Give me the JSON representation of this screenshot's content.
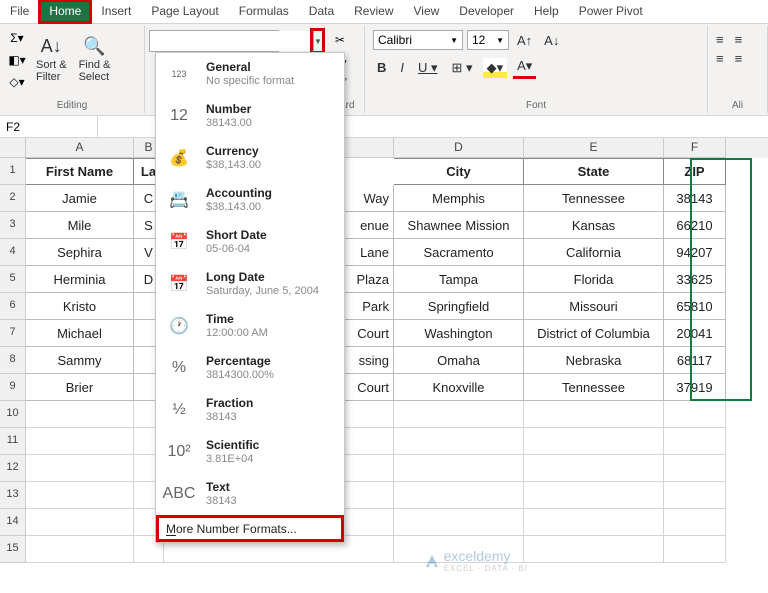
{
  "menu": [
    "File",
    "Home",
    "Insert",
    "Page Layout",
    "Formulas",
    "Data",
    "Review",
    "View",
    "Developer",
    "Help",
    "Power Pivot"
  ],
  "menu_active_index": 1,
  "ribbon": {
    "editing": {
      "sort_filter": "Sort &\nFilter",
      "find_select": "Find &\nSelect",
      "group_label": "Editing"
    },
    "font": {
      "name": "Calibri",
      "size": "12",
      "group_label": "Font"
    },
    "align": {
      "group_label": "Ali"
    },
    "board_label": "oard"
  },
  "numfmt_dropdown": [
    {
      "title": "General",
      "sub": "No specific format",
      "icon": "123"
    },
    {
      "title": "Number",
      "sub": "38143.00",
      "icon": "12"
    },
    {
      "title": "Currency",
      "sub": "$38,143.00",
      "icon": "coins"
    },
    {
      "title": "Accounting",
      "sub": "$38,143.00",
      "icon": "ledger"
    },
    {
      "title": "Short Date",
      "sub": "05-06-04",
      "icon": "cal"
    },
    {
      "title": "Long Date",
      "sub": "Saturday, June 5, 2004",
      "icon": "cal"
    },
    {
      "title": "Time",
      "sub": "12:00:00 AM",
      "icon": "clock"
    },
    {
      "title": "Percentage",
      "sub": "3814300.00%",
      "icon": "%"
    },
    {
      "title": "Fraction",
      "sub": "38143",
      "icon": "½"
    },
    {
      "title": "Scientific",
      "sub": "3.81E+04",
      "icon": "10²"
    },
    {
      "title": "Text",
      "sub": "38143",
      "icon": "ABC"
    }
  ],
  "numfmt_footer": "More Number Formats...",
  "namebox": "F2",
  "columns": [
    "A",
    "B",
    "",
    "D",
    "E",
    "F"
  ],
  "headers": {
    "A": "First Name",
    "B": "La",
    "D": "City",
    "E": "State",
    "F": "ZIP"
  },
  "rows": [
    {
      "A": "Jamie",
      "B": "C",
      "C": "Way",
      "D": "Memphis",
      "E": "Tennessee",
      "F": "38143"
    },
    {
      "A": "Mile",
      "B": "S",
      "C": "enue",
      "D": "Shawnee Mission",
      "E": "Kansas",
      "F": "66210"
    },
    {
      "A": "Sephira",
      "B": "V",
      "C": "Lane",
      "D": "Sacramento",
      "E": "California",
      "F": "94207"
    },
    {
      "A": "Herminia",
      "B": "D",
      "C": "Plaza",
      "D": "Tampa",
      "E": "Florida",
      "F": "33625"
    },
    {
      "A": "Kristo",
      "B": "",
      "C": "Park",
      "D": "Springfield",
      "E": "Missouri",
      "F": "65810"
    },
    {
      "A": "Michael",
      "B": "",
      "C": "Court",
      "D": "Washington",
      "E": "District of Columbia",
      "F": "20041"
    },
    {
      "A": "Sammy",
      "B": "",
      "C": "ssing",
      "D": "Omaha",
      "E": "Nebraska",
      "F": "68117"
    },
    {
      "A": "Brier",
      "B": "",
      "C": "Court",
      "D": "Knoxville",
      "E": "Tennessee",
      "F": "37919"
    }
  ],
  "watermark": {
    "brand": "exceldemy",
    "tagline": "EXCEL · DATA · BI"
  }
}
